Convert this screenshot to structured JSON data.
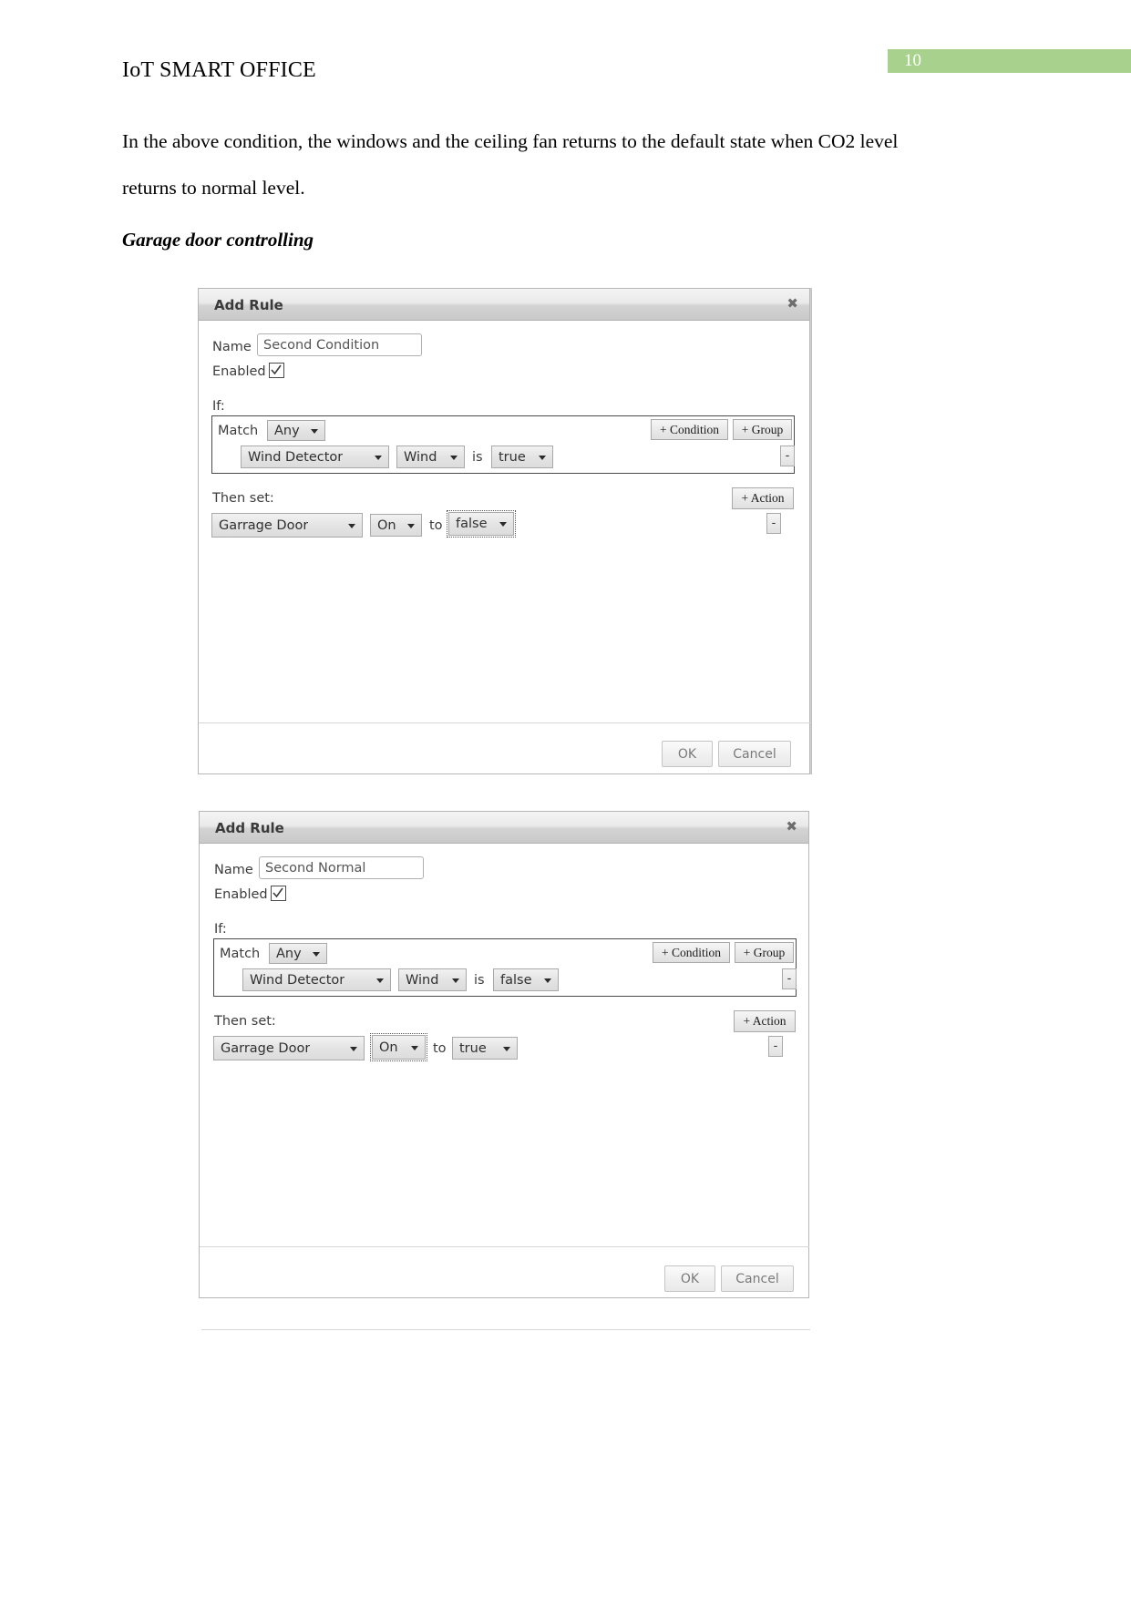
{
  "page": {
    "number": "10",
    "badge_color": "#a9d18e",
    "header_title": "IoT SMART OFFICE",
    "paragraph": "In the above condition, the windows and the ceiling fan returns to the default state when CO2 level returns to normal level.",
    "subheading": "Garage door controlling"
  },
  "dialogs": [
    {
      "title": "Add Rule",
      "close_label": "✖",
      "name_label": "Name",
      "name_value": "Second Condition",
      "name_placeholder": "Rule name",
      "enabled_label": "Enabled",
      "enabled_checked": true,
      "if_label": "If:",
      "match_label": "Match",
      "match_value": "Any",
      "add_condition_label": "+ Condition",
      "add_group_label": "+ Group",
      "remove_label": "-",
      "condition": {
        "device": "Wind Detector",
        "property": "Wind",
        "operator": "is",
        "value": "true",
        "focused": ""
      },
      "then_label": "Then set:",
      "add_action_label": "+ Action",
      "action": {
        "device": "Garrage Door",
        "property": "On",
        "connector": "to",
        "value": "false",
        "focused": "value"
      },
      "ok_label": "OK",
      "cancel_label": "Cancel"
    },
    {
      "title": "Add Rule",
      "close_label": "✖",
      "name_label": "Name",
      "name_value": "Second Normal",
      "name_placeholder": "Rule name",
      "enabled_label": "Enabled",
      "enabled_checked": true,
      "if_label": "If:",
      "match_label": "Match",
      "match_value": "Any",
      "add_condition_label": "+ Condition",
      "add_group_label": "+ Group",
      "remove_label": "-",
      "condition": {
        "device": "Wind Detector",
        "property": "Wind",
        "operator": "is",
        "value": "false",
        "focused": ""
      },
      "then_label": "Then set:",
      "add_action_label": "+ Action",
      "action": {
        "device": "Garrage Door",
        "property": "On",
        "connector": "to",
        "value": "true",
        "focused": "property"
      },
      "ok_label": "OK",
      "cancel_label": "Cancel"
    }
  ]
}
